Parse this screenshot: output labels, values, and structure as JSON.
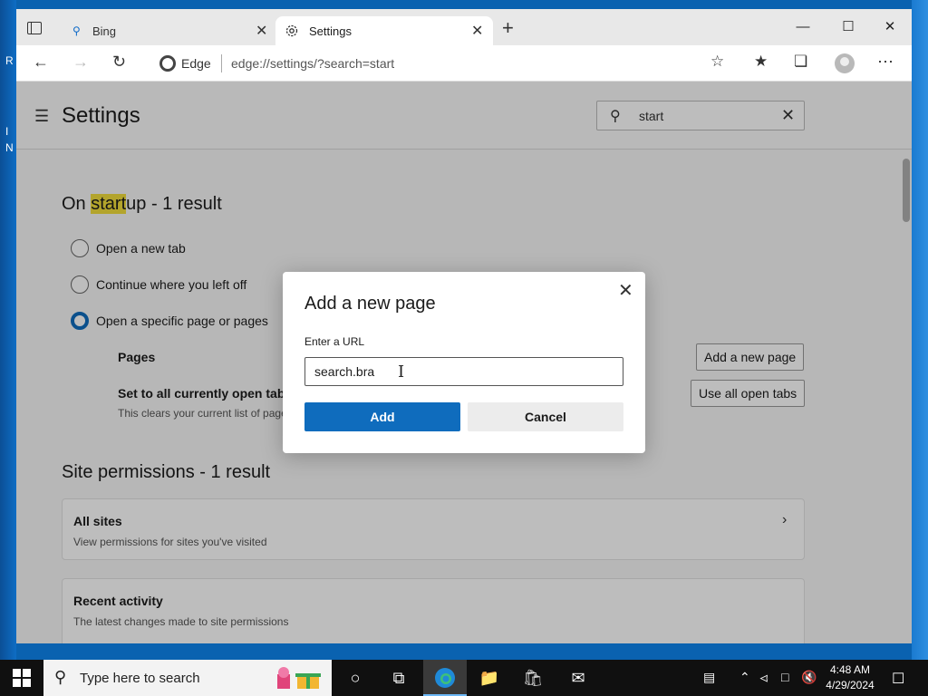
{
  "desktop": {
    "glyphs": [
      "R",
      "I",
      "N"
    ]
  },
  "browser": {
    "tabs": [
      {
        "title": "Bing"
      },
      {
        "title": "Settings"
      }
    ],
    "new_tab_symbol": "+",
    "edge_label": "Edge",
    "address": "edge://settings/?search=start",
    "window_controls": {
      "minimize": "—",
      "maximize": "☐",
      "close": "✕"
    }
  },
  "settings": {
    "title": "Settings",
    "search_value": "start",
    "startup": {
      "title_prefix": "On ",
      "title_highlight": "start",
      "title_suffix": "up - 1 result",
      "options": [
        {
          "label": "Open a new tab",
          "checked": false
        },
        {
          "label": "Continue where you left off",
          "checked": false
        },
        {
          "label": "Open a specific page or pages",
          "checked": true
        }
      ],
      "pages_label": "Pages",
      "add_page_button": "Add a new page",
      "set_open_tabs_label": "Set to all currently open tabs",
      "set_open_tabs_desc": "This clears your current list of pages",
      "use_open_tabs_button": "Use all open tabs"
    },
    "site_permissions": {
      "title": "Site permissions - 1 result",
      "cards": [
        {
          "title": "All sites",
          "desc": "View permissions for sites you've visited"
        },
        {
          "title": "Recent activity",
          "desc": "The latest changes made to site permissions"
        }
      ]
    }
  },
  "dialog": {
    "title": "Add a new page",
    "url_label": "Enter a URL",
    "url_value": "search.bra",
    "add_button": "Add",
    "cancel_button": "Cancel"
  },
  "taskbar": {
    "search_placeholder": "Type here to search",
    "time": "4:48 AM",
    "date": "4/29/2024"
  },
  "colors": {
    "accent": "#0f6cbd",
    "highlight": "#f2dd3c",
    "taskbar": "#101010"
  }
}
